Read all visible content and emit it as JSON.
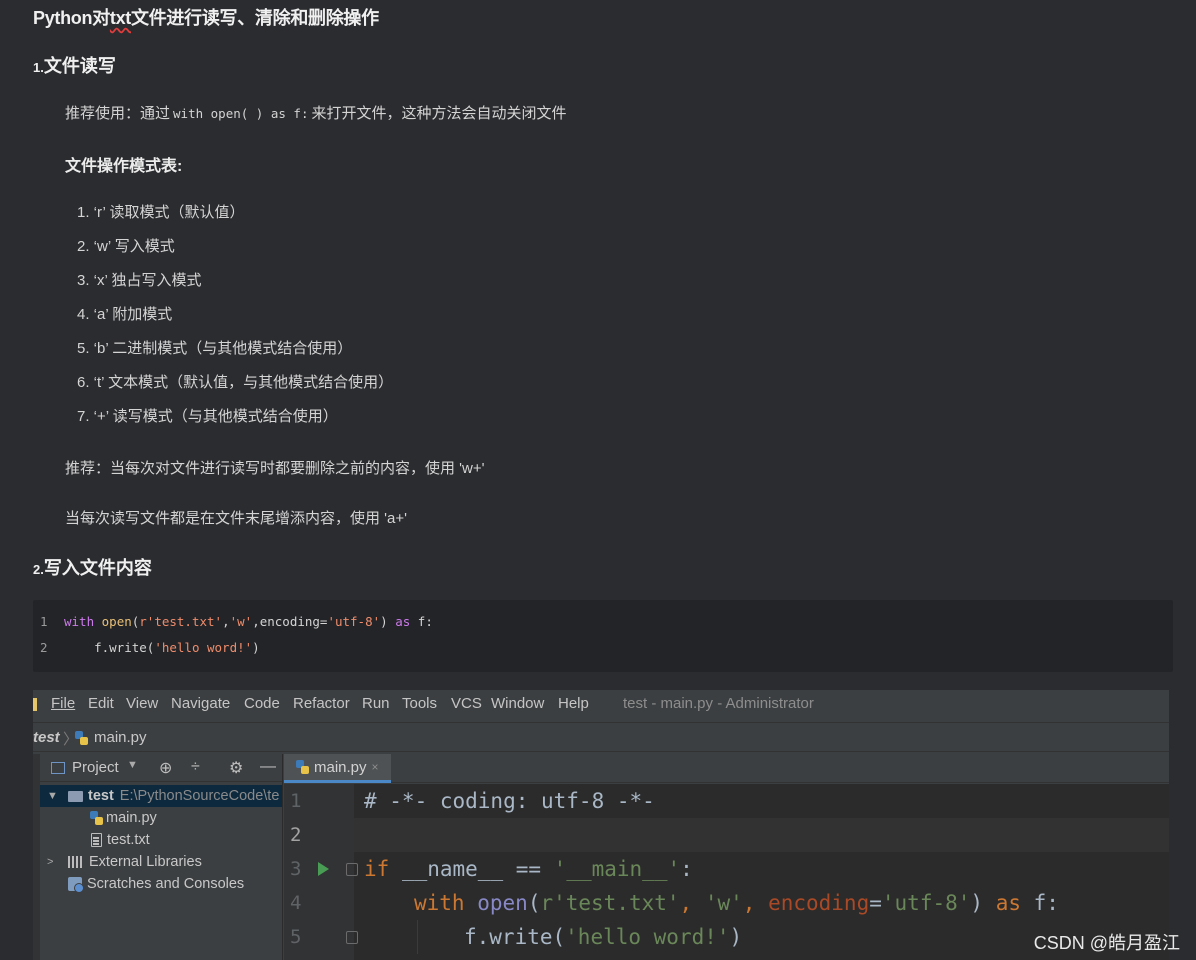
{
  "article": {
    "title_prefix": "Python对",
    "title_txt": "txt",
    "title_suffix": "文件进行读写、清除和删除操作",
    "section1": {
      "num": "1.",
      "title": "文件读写"
    },
    "recommend_prefix": "推荐使用：通过",
    "recommend_code": "with open( ) as f:",
    "recommend_suffix": "来打开文件，这种方法会自动关闭文件",
    "modes_title": "文件操作模式表:",
    "modes": [
      "1. ‘r’ 读取模式（默认值）",
      "2. ‘w’ 写入模式",
      "3. ‘x’ 独占写入模式",
      "4. ‘a’ 附加模式",
      "5. ‘b’ 二进制模式（与其他模式结合使用）",
      "6. ‘t’ 文本模式（默认值，与其他模式结合使用）",
      "7. ‘+’ 读写模式（与其他模式结合使用）"
    ],
    "tip1": "推荐：当每次对文件进行读写时都要删除之前的内容，使用 'w+'",
    "tip2": "当每次读写文件都是在文件末尾增添内容，使用 'a+'",
    "section2": {
      "num": "2.",
      "title": "写入文件内容"
    },
    "code_lines": {
      "l1_num": "1",
      "l2_num": "2",
      "l1_with": "with",
      "l1_open": "open",
      "l1_p1": "(",
      "l1_s1": "r'test.txt'",
      "l1_c1": ",",
      "l1_s2": "'w'",
      "l1_enc": ",encoding=",
      "l1_s3": "'utf-8'",
      "l1_p2": ") ",
      "l1_as": "as",
      "l1_f": " f:",
      "l2_a": "    f.write(",
      "l2_s": "'hello word!'",
      "l2_b": ")"
    }
  },
  "ide": {
    "menu": [
      "File",
      "Edit",
      "View",
      "Navigate",
      "Code",
      "Refactor",
      "Run",
      "Tools",
      "VCS",
      "Window",
      "Help"
    ],
    "window_title": "test - main.py - Administrator",
    "breadcrumb_root": "test",
    "breadcrumb_sep": "〉",
    "breadcrumb_file": "main.py",
    "project_label": "Project",
    "project_dropdown": "▼",
    "tree": {
      "root_name": "test",
      "root_path": "E:\\PythonSourceCode\\te",
      "main_py": "main.py",
      "test_txt": "test.txt",
      "ext_libs": "External Libraries",
      "scratches": "Scratches and Consoles"
    },
    "tab_label": "main.py",
    "tab_close": "×",
    "editor": {
      "gutter": [
        "1",
        "2",
        "3",
        "4",
        "5"
      ],
      "line1": "# -*- coding: utf-8 -*-",
      "l3_if": "if",
      "l3_mid": " __name__ == ",
      "l3_str": "'__main__'",
      "l3_end": ":",
      "l4_with": "with",
      "l4_open": "open",
      "l4_p1": "(",
      "l4_s1": "r'test.txt'",
      "l4_c1": ", ",
      "l4_s2": "'w'",
      "l4_c2": ", ",
      "l4_param": "encoding",
      "l4_eq": "=",
      "l4_s3": "'utf-8'",
      "l4_p2": ") ",
      "l4_as": "as",
      "l4_f": " f:",
      "l5_a": "f.write(",
      "l5_s": "'hello word!'",
      "l5_b": ")"
    }
  },
  "watermark": "CSDN @皓月盈江"
}
